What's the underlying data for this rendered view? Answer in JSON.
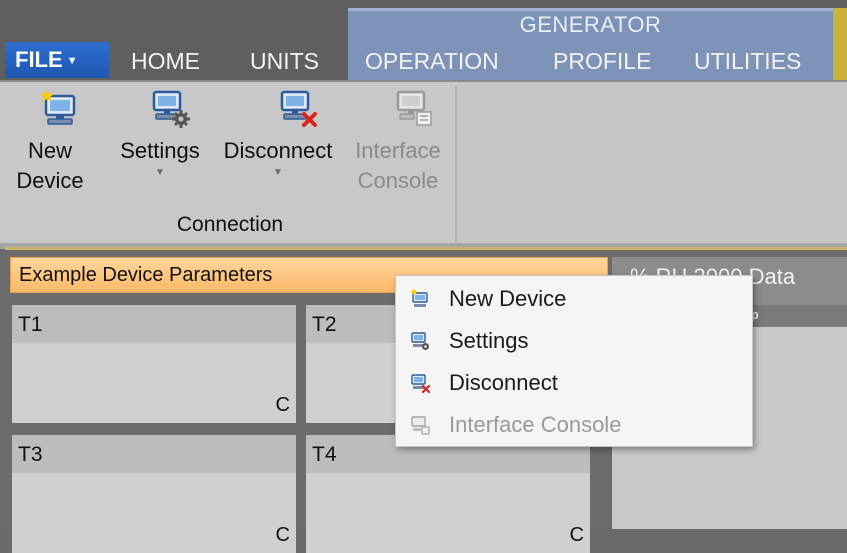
{
  "menu_tabs": {
    "file": "FILE",
    "home": "HOME",
    "units": "UNITS",
    "generator_group": "GENERATOR",
    "operation": "OPERATION",
    "profile": "PROFILE",
    "utilities": "UTILITIES"
  },
  "ribbon": {
    "new_device": [
      "New",
      "Device"
    ],
    "settings": "Settings",
    "disconnect": "Disconnect",
    "interface_console": [
      "Interface",
      "Console"
    ],
    "group_label": "Connection"
  },
  "panel": {
    "title": "Example Device Parameters",
    "tiles": [
      {
        "label": "T1",
        "unit": "C"
      },
      {
        "label": "T2",
        "unit": ""
      },
      {
        "label": "T3",
        "unit": "C"
      },
      {
        "label": "T4",
        "unit": "C"
      }
    ]
  },
  "right_panel": {
    "header": "% RH    2000 Data",
    "column": "amp"
  },
  "context_menu": {
    "items": [
      {
        "label": "New Device",
        "icon": "new-device-icon",
        "enabled": true
      },
      {
        "label": "Settings",
        "icon": "settings-icon",
        "enabled": true
      },
      {
        "label": "Disconnect",
        "icon": "disconnect-icon",
        "enabled": true
      },
      {
        "label": "Interface Console",
        "icon": "interface-console-icon",
        "enabled": false
      }
    ]
  },
  "colors": {
    "file_tab": "#1f56b0",
    "generator_band": "#7e93b8",
    "panel_header": "#fbb96a",
    "disconnect_x": "#d9221c"
  }
}
